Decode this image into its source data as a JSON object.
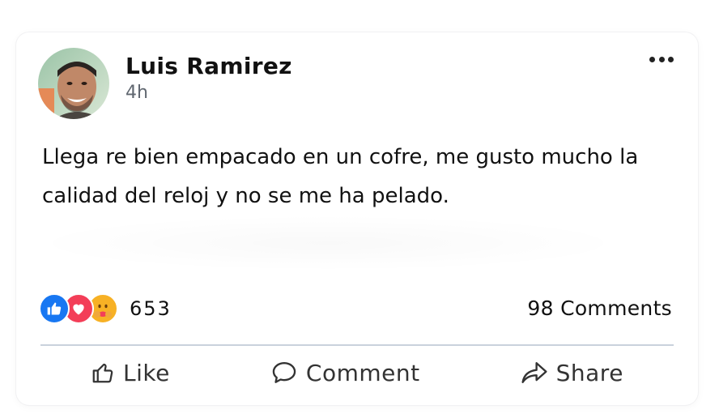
{
  "post": {
    "author": "Luis Ramirez",
    "time": "4h",
    "text": "Llega re bien empacado en un cofre, me gusto mucho la calidad del reloj y no se me ha pelado.",
    "more_icon": "more-horizontal-icon"
  },
  "reactions": {
    "icons": [
      "like-reaction-icon",
      "love-reaction-icon",
      "care-reaction-icon"
    ],
    "count": "653"
  },
  "comments": {
    "label": "98 Comments"
  },
  "actions": {
    "like": {
      "label": "Like",
      "icon": "thumbs-up-icon"
    },
    "comment": {
      "label": "Comment",
      "icon": "comment-bubble-icon"
    },
    "share": {
      "label": "Share",
      "icon": "share-arrow-icon"
    }
  },
  "colors": {
    "like_blue": "#1877f2",
    "love_red": "#f33e58",
    "care_yellow": "#f7b125",
    "divider": "#c9d1dc"
  }
}
